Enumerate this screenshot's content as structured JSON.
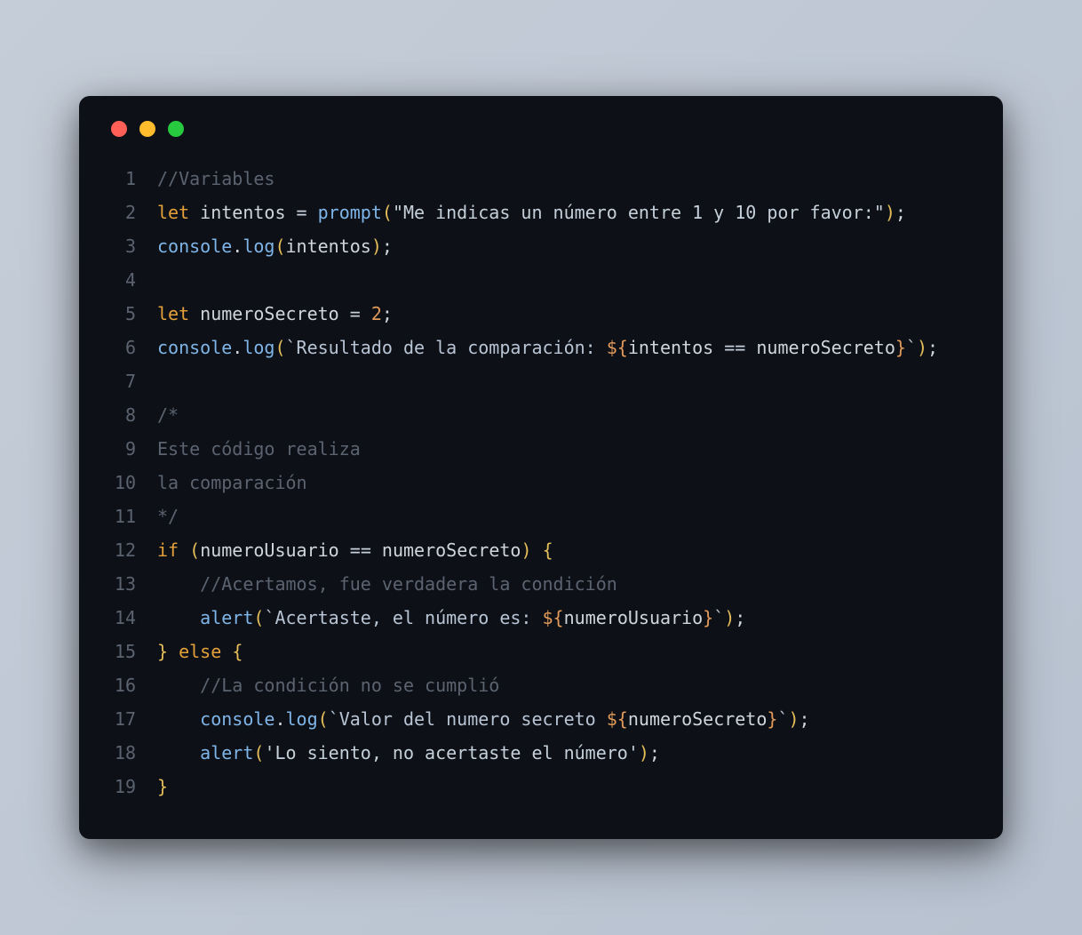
{
  "window": {
    "traffic_lights": {
      "red": "#ff5f56",
      "yellow": "#ffbd2e",
      "green": "#27c93f"
    }
  },
  "code": {
    "lines": [
      {
        "n": "1",
        "tokens": [
          {
            "t": "//Variables",
            "c": "comment"
          }
        ]
      },
      {
        "n": "2",
        "tokens": [
          {
            "t": "let",
            "c": "keyword"
          },
          {
            "t": " ",
            "c": "ident"
          },
          {
            "t": "intentos",
            "c": "ident"
          },
          {
            "t": " ",
            "c": "ident"
          },
          {
            "t": "=",
            "c": "op"
          },
          {
            "t": " ",
            "c": "ident"
          },
          {
            "t": "prompt",
            "c": "func"
          },
          {
            "t": "(",
            "c": "paren"
          },
          {
            "t": "\"Me indicas un número entre 1 y 10 por favor:\"",
            "c": "string"
          },
          {
            "t": ")",
            "c": "paren"
          },
          {
            "t": ";",
            "c": "ident"
          }
        ]
      },
      {
        "n": "3",
        "tokens": [
          {
            "t": "console",
            "c": "method-obj"
          },
          {
            "t": ".",
            "c": "ident"
          },
          {
            "t": "log",
            "c": "func"
          },
          {
            "t": "(",
            "c": "paren"
          },
          {
            "t": "intentos",
            "c": "ident"
          },
          {
            "t": ")",
            "c": "paren"
          },
          {
            "t": ";",
            "c": "ident"
          }
        ]
      },
      {
        "n": "4",
        "tokens": []
      },
      {
        "n": "5",
        "tokens": [
          {
            "t": "let",
            "c": "keyword"
          },
          {
            "t": " ",
            "c": "ident"
          },
          {
            "t": "numeroSecreto",
            "c": "ident"
          },
          {
            "t": " ",
            "c": "ident"
          },
          {
            "t": "=",
            "c": "op"
          },
          {
            "t": " ",
            "c": "ident"
          },
          {
            "t": "2",
            "c": "number"
          },
          {
            "t": ";",
            "c": "ident"
          }
        ]
      },
      {
        "n": "6",
        "tokens": [
          {
            "t": "console",
            "c": "method-obj"
          },
          {
            "t": ".",
            "c": "ident"
          },
          {
            "t": "log",
            "c": "func"
          },
          {
            "t": "(",
            "c": "paren"
          },
          {
            "t": "`Resultado de la comparación: ",
            "c": "template"
          },
          {
            "t": "${",
            "c": "interp"
          },
          {
            "t": "intentos",
            "c": "interp-var"
          },
          {
            "t": " ",
            "c": "interp-var"
          },
          {
            "t": "==",
            "c": "op"
          },
          {
            "t": " ",
            "c": "interp-var"
          },
          {
            "t": "numeroSecreto",
            "c": "interp-var"
          },
          {
            "t": "}",
            "c": "interp"
          },
          {
            "t": "`",
            "c": "template"
          },
          {
            "t": ")",
            "c": "paren"
          },
          {
            "t": ";",
            "c": "ident"
          }
        ]
      },
      {
        "n": "7",
        "tokens": []
      },
      {
        "n": "8",
        "tokens": [
          {
            "t": "/*",
            "c": "comment"
          }
        ]
      },
      {
        "n": "9",
        "tokens": [
          {
            "t": "Este código realiza",
            "c": "comment"
          }
        ]
      },
      {
        "n": "10",
        "tokens": [
          {
            "t": "la comparación",
            "c": "comment"
          }
        ]
      },
      {
        "n": "11",
        "tokens": [
          {
            "t": "*/",
            "c": "comment"
          }
        ]
      },
      {
        "n": "12",
        "tokens": [
          {
            "t": "if",
            "c": "keyword"
          },
          {
            "t": " ",
            "c": "ident"
          },
          {
            "t": "(",
            "c": "paren"
          },
          {
            "t": "numeroUsuario",
            "c": "ident"
          },
          {
            "t": " ",
            "c": "ident"
          },
          {
            "t": "==",
            "c": "op"
          },
          {
            "t": " ",
            "c": "ident"
          },
          {
            "t": "numeroSecreto",
            "c": "ident"
          },
          {
            "t": ")",
            "c": "paren"
          },
          {
            "t": " ",
            "c": "ident"
          },
          {
            "t": "{",
            "c": "brace"
          }
        ]
      },
      {
        "n": "13",
        "tokens": [
          {
            "t": "    ",
            "c": "ident"
          },
          {
            "t": "//Acertamos, fue verdadera la condición",
            "c": "comment"
          }
        ]
      },
      {
        "n": "14",
        "tokens": [
          {
            "t": "    ",
            "c": "ident"
          },
          {
            "t": "alert",
            "c": "func"
          },
          {
            "t": "(",
            "c": "paren"
          },
          {
            "t": "`Acertaste, el número es: ",
            "c": "template"
          },
          {
            "t": "${",
            "c": "interp"
          },
          {
            "t": "numeroUsuario",
            "c": "interp-var"
          },
          {
            "t": "}",
            "c": "interp"
          },
          {
            "t": "`",
            "c": "template"
          },
          {
            "t": ")",
            "c": "paren"
          },
          {
            "t": ";",
            "c": "ident"
          }
        ]
      },
      {
        "n": "15",
        "tokens": [
          {
            "t": "}",
            "c": "brace"
          },
          {
            "t": " ",
            "c": "ident"
          },
          {
            "t": "else",
            "c": "keyword"
          },
          {
            "t": " ",
            "c": "ident"
          },
          {
            "t": "{",
            "c": "brace"
          }
        ]
      },
      {
        "n": "16",
        "tokens": [
          {
            "t": "    ",
            "c": "ident"
          },
          {
            "t": "//La condición no se cumplió",
            "c": "comment"
          }
        ]
      },
      {
        "n": "17",
        "tokens": [
          {
            "t": "    ",
            "c": "ident"
          },
          {
            "t": "console",
            "c": "method-obj"
          },
          {
            "t": ".",
            "c": "ident"
          },
          {
            "t": "log",
            "c": "func"
          },
          {
            "t": "(",
            "c": "paren"
          },
          {
            "t": "`Valor del numero secreto ",
            "c": "template"
          },
          {
            "t": "${",
            "c": "interp"
          },
          {
            "t": "numeroSecreto",
            "c": "interp-var"
          },
          {
            "t": "}",
            "c": "interp"
          },
          {
            "t": "`",
            "c": "template"
          },
          {
            "t": ")",
            "c": "paren"
          },
          {
            "t": ";",
            "c": "ident"
          }
        ]
      },
      {
        "n": "18",
        "tokens": [
          {
            "t": "    ",
            "c": "ident"
          },
          {
            "t": "alert",
            "c": "func"
          },
          {
            "t": "(",
            "c": "paren"
          },
          {
            "t": "'Lo siento, no acertaste el número'",
            "c": "string"
          },
          {
            "t": ")",
            "c": "paren"
          },
          {
            "t": ";",
            "c": "ident"
          }
        ]
      },
      {
        "n": "19",
        "tokens": [
          {
            "t": "}",
            "c": "brace"
          }
        ]
      }
    ]
  }
}
